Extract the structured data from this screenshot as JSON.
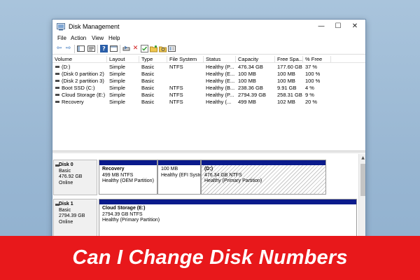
{
  "window": {
    "title": "Disk Management",
    "minimize_glyph": "—",
    "maximize_glyph": "☐",
    "close_glyph": "✕"
  },
  "menu": [
    "File",
    "Action",
    "View",
    "Help"
  ],
  "toolbar": {
    "icons": [
      "back-arrow-icon",
      "forward-arrow-icon",
      "console-tree-icon",
      "properties-icon",
      "help-icon",
      "list-view-icon",
      "connect-drive-icon",
      "delete-icon",
      "check-icon",
      "new-folder-icon",
      "search-icon",
      "settings-icon"
    ],
    "back_glyph": "⇦",
    "forward_glyph": "⇨",
    "help_glyph": "?",
    "delete_glyph": "✕"
  },
  "volume_list": {
    "columns": [
      "Volume",
      "Layout",
      "Type",
      "File System",
      "Status",
      "Capacity",
      "Free Spa...",
      "% Free"
    ],
    "rows": [
      [
        "(D:)",
        "Simple",
        "Basic",
        "NTFS",
        "Healthy (P...",
        "476.34 GB",
        "177.60 GB",
        "37 %"
      ],
      [
        "(Disk 0 partition 2)",
        "Simple",
        "Basic",
        "",
        "Healthy (E...",
        "100 MB",
        "100 MB",
        "100 %"
      ],
      [
        "(Disk 2 partition 3)",
        "Simple",
        "Basic",
        "",
        "Healthy (E...",
        "100 MB",
        "100 MB",
        "100 %"
      ],
      [
        "Boot SSD (C:)",
        "Simple",
        "Basic",
        "NTFS",
        "Healthy (B...",
        "238.36 GB",
        "9.91 GB",
        "4 %"
      ],
      [
        "Cloud Storage (E:)",
        "Simple",
        "Basic",
        "NTFS",
        "Healthy (P...",
        "2794.39 GB",
        "258.31 GB",
        "9 %"
      ],
      [
        "Recovery",
        "Simple",
        "Basic",
        "NTFS",
        "Healthy (...",
        "499 MB",
        "102 MB",
        "20 %"
      ]
    ]
  },
  "disks": [
    {
      "name": "Disk 0",
      "type": "Basic",
      "size": "476.92 GB",
      "status": "Online",
      "partitions": [
        {
          "name": "Recovery",
          "size_fs": "499 MB NTFS",
          "status": "Healthy (OEM Partition)"
        },
        {
          "name": "",
          "size_fs": "100 MB",
          "status": "Healthy (EFI Syste"
        },
        {
          "name": "(D:)",
          "size_fs": "476.34 GB NTFS",
          "status": "Healthy (Primary Partition)"
        }
      ]
    },
    {
      "name": "Disk 1",
      "type": "Basic",
      "size": "2794.39 GB",
      "status": "Online",
      "partitions": [
        {
          "name": "Cloud Storage  (E:)",
          "size_fs": "2794.39 GB NTFS",
          "status": "Healthy (Primary Partition)"
        }
      ]
    }
  ],
  "banner": {
    "text": "Can I Change Disk Numbers"
  },
  "colors": {
    "partition_bar": "#0a1a8c",
    "banner_bg": "#e8181b",
    "desktop_bg": "#9cb9d4"
  }
}
